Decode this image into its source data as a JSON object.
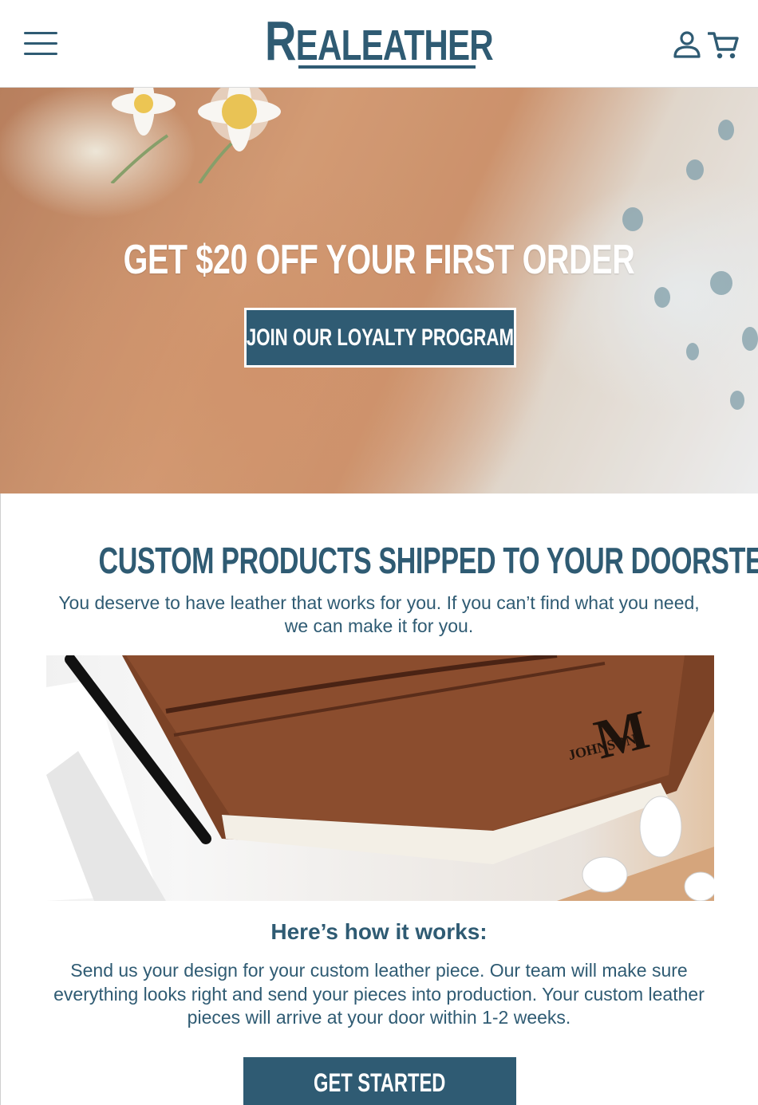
{
  "header": {
    "menu_icon": "hamburger-menu-icon",
    "logo_first": "R",
    "logo_rest": "EALEATHER",
    "account_icon": "user-icon",
    "cart_icon": "cart-icon"
  },
  "hero": {
    "title": "GET $20 OFF YOUR FIRST ORDER",
    "button_label": "JOIN OUR LOYALTY PROGRAM"
  },
  "custom": {
    "title": "CUSTOM PRODUCTS SHIPPED TO YOUR DOORSTEP",
    "intro": "You deserve to have leather that works for you. If you can’t find what you need, we can make it for you.",
    "monogram_letter": "M",
    "monogram_name": "JOHNSON"
  },
  "how": {
    "title": "Here’s how it works:",
    "text": "Send us your design for your custom leather piece. Our team will make sure everything looks right and send your pieces into production. Your custom leather pieces will arrive at your door  within 1-2 weeks.",
    "button_label": "GET STARTED"
  },
  "colors": {
    "brand": "#2f5b73",
    "leather": "#8a4a2c",
    "background": "#ffffff"
  }
}
